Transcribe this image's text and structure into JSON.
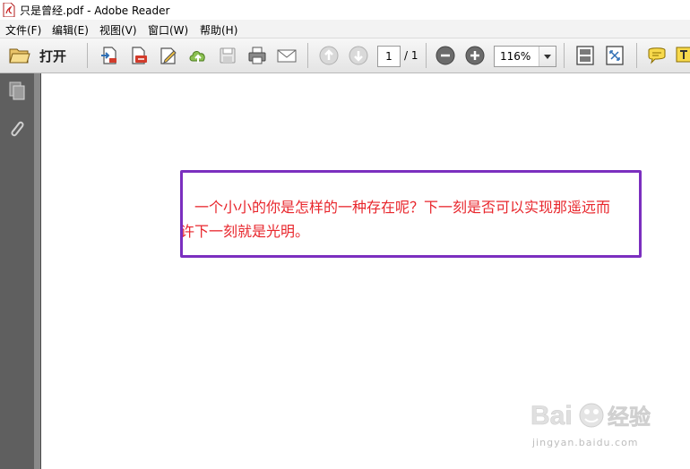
{
  "window": {
    "title": "只是曾经.pdf - Adobe Reader"
  },
  "menu": {
    "items": [
      "文件(F)",
      "编辑(E)",
      "视图(V)",
      "窗口(W)",
      "帮助(H)"
    ]
  },
  "toolbar": {
    "open_label": "打开",
    "page_current": "1",
    "page_total": "/ 1",
    "zoom": "116%",
    "icons": [
      "folder-icon",
      "create-pdf-icon",
      "export-pdf-icon",
      "edit-pdf-icon",
      "upload-cloud-icon",
      "save-icon",
      "print-icon",
      "email-icon",
      "previous-page-icon",
      "next-page-icon",
      "zoom-out-icon",
      "zoom-in-icon",
      "fit-page-icon",
      "full-screen-icon",
      "comment-icon",
      "highlight-text-icon"
    ]
  },
  "left_panel": {
    "icons": [
      "page-thumbnails-icon",
      "attachments-icon"
    ]
  },
  "document": {
    "line1": "一个小小的你是怎样的一种存在呢？下一刻是否可以实现那遥远而",
    "line2": "许下一刻就是光明。",
    "text_color": "#e8262c",
    "highlight_color": "#7b2fbf"
  },
  "watermark": {
    "text": "jingyan.baidu.com"
  }
}
